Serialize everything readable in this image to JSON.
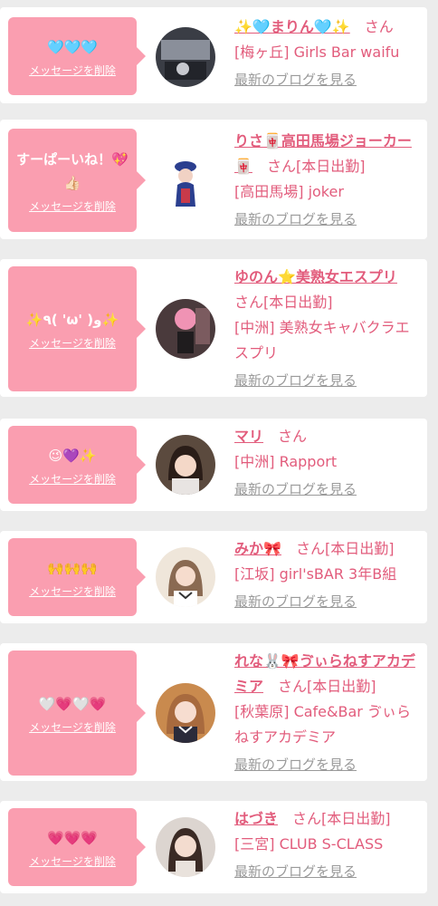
{
  "delete_label": "メッセージを削除",
  "san_label": "さん",
  "blog_label": "最新のブログを見る",
  "colors": {
    "accent": "#e25c7c",
    "bubble": "#fa9eb0",
    "link_gray": "#9a9a9a",
    "background": "#ececec"
  },
  "cards": [
    {
      "message": "🩵🩵🩵",
      "name": "✨🩵まりん🩵✨",
      "status": "",
      "shop": "[梅ヶ丘] Girls Bar waifu"
    },
    {
      "message": "すーぱーいね！💖👍🏻",
      "name": "りさ🀄高田馬場ジョーカー🀄",
      "status": "[本日出勤]",
      "shop": "[高田馬場] joker"
    },
    {
      "message": "✨٩( 'ω' )و✨",
      "name": "ゆのん⭐美熟女エスプリ",
      "status": "[本日出勤]",
      "shop": "[中洲] 美熟女キャバクラエスプリ"
    },
    {
      "message": "😉💜✨",
      "name": "マリ",
      "status": "",
      "shop": "[中洲] Rapport"
    },
    {
      "message": "🙌🙌🙌",
      "name": "みか🎀",
      "status": "[本日出勤]",
      "shop": "[江坂] girl'sBAR 3年B組"
    },
    {
      "message": "🤍💗🤍💗",
      "name": "れな🐰🎀ゔぃらねすアカデミア",
      "status": "[本日出勤]",
      "shop": "[秋葉原] Cafe&Bar ゔぃらねすアカデミア"
    },
    {
      "message": "💗💗💗",
      "name": "はづき",
      "status": "[本日出勤]",
      "shop": "[三宮] CLUB S-CLASS"
    }
  ]
}
